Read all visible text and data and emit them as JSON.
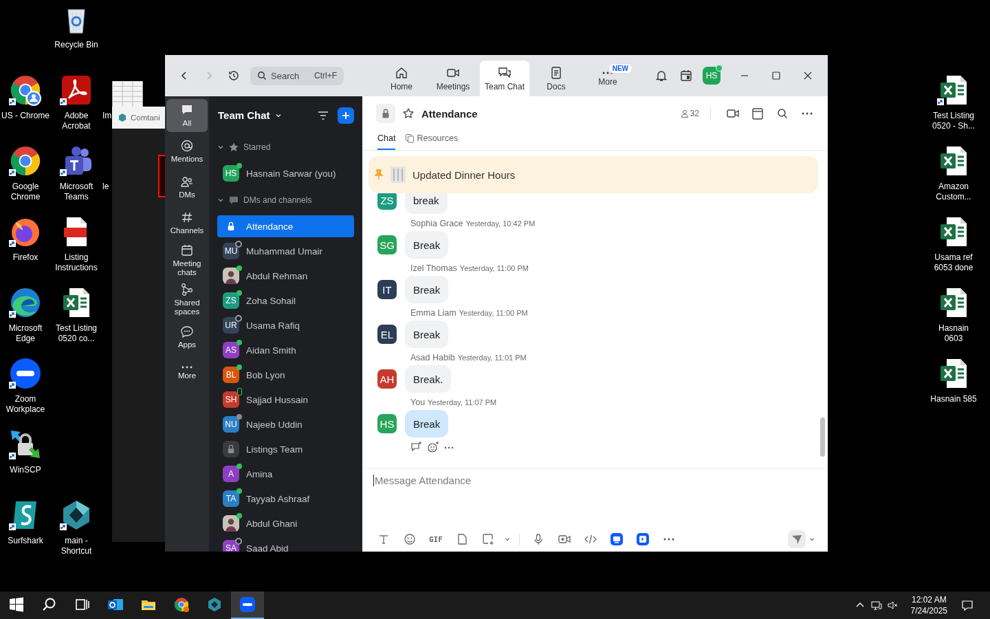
{
  "desktop": {
    "icons": [
      {
        "kind": "recycle",
        "label": "Recycle Bin",
        "shortcut": false
      },
      {
        "kind": "chrome-profile",
        "label": "US - Chrome",
        "shortcut": true
      },
      {
        "kind": "acrobat",
        "label": "Adobe Acrobat",
        "shortcut": true
      },
      {
        "kind": "chrome",
        "label": "Google Chrome",
        "shortcut": true
      },
      {
        "kind": "teams",
        "label": "Microsoft Teams",
        "shortcut": true
      },
      {
        "kind": "firefox",
        "label": "Firefox",
        "shortcut": true
      },
      {
        "kind": "pdf",
        "label": "Listing Instructions",
        "shortcut": false
      },
      {
        "kind": "edge",
        "label": "Microsoft Edge",
        "shortcut": true
      },
      {
        "kind": "excel",
        "label": "Test Listing 0520 co...",
        "shortcut": false
      },
      {
        "kind": "zoom",
        "label": "Zoom Workplace",
        "shortcut": true
      },
      {
        "kind": "winscp",
        "label": "WinSCP",
        "shortcut": true
      },
      {
        "kind": "surfshark",
        "label": "Surfshark",
        "shortcut": true
      },
      {
        "kind": "hexagon",
        "label": "main - Shortcut",
        "shortcut": true
      },
      {
        "kind": "sheet-thumb",
        "label": "Im",
        "shortcut": false
      },
      {
        "kind": "none",
        "label": "le",
        "shortcut": false
      },
      {
        "kind": "excel",
        "label": "Test Listing 0520 - Sh...",
        "shortcut": true
      },
      {
        "kind": "excel",
        "label": "Amazon Custom...",
        "shortcut": false
      },
      {
        "kind": "excel",
        "label": "Usama ref 6053 done",
        "shortcut": false
      },
      {
        "kind": "excel",
        "label": "Hasnain 0603",
        "shortcut": false
      },
      {
        "kind": "excel",
        "label": "Hasnain 585",
        "shortcut": false
      }
    ]
  },
  "background_window": {
    "title": "Comtani"
  },
  "zoom": {
    "search": {
      "placeholder": "Search",
      "shortcut": "Ctrl+F"
    },
    "tabs": [
      {
        "kind": "home",
        "label": "Home",
        "selected": false
      },
      {
        "kind": "meetings",
        "label": "Meetings",
        "selected": false
      },
      {
        "kind": "chat",
        "label": "Team Chat",
        "selected": true
      },
      {
        "kind": "docs",
        "label": "Docs",
        "selected": false
      },
      {
        "kind": "more",
        "label": "More",
        "selected": false,
        "badge": "NEW"
      }
    ],
    "account": {
      "initials": "HS",
      "status": {
        "kind": "dot",
        "color": "#20c05c"
      }
    },
    "rail": [
      {
        "kind": "all",
        "label": "All",
        "selected": true
      },
      {
        "kind": "mentions",
        "label": "Mentions",
        "selected": false
      },
      {
        "kind": "dms",
        "label": "DMs",
        "selected": false
      },
      {
        "kind": "channels",
        "label": "Channels",
        "selected": false
      },
      {
        "kind": "meeting-chats",
        "label": "Meeting chats",
        "selected": false
      },
      {
        "kind": "shared",
        "label": "Shared spaces",
        "selected": false
      },
      {
        "kind": "apps",
        "label": "Apps",
        "selected": false
      },
      {
        "kind": "more",
        "label": "More",
        "selected": false
      }
    ],
    "list": {
      "title": "Team Chat",
      "sections": [
        {
          "kind": "starred",
          "label": "Starred",
          "expanded": true,
          "items": [
            {
              "kind": "person",
              "name": "Hasnain Sarwar (you)",
              "initials": "HS",
              "color": "#22a559",
              "status": {
                "kind": "dot",
                "color": "#2bc35c"
              },
              "selected": false
            }
          ]
        },
        {
          "kind": "dms",
          "label": "DMs and channels",
          "expanded": true,
          "items": [
            {
              "kind": "channel",
              "name": "Attendance",
              "selected": true
            },
            {
              "kind": "person",
              "name": "Muhammad Umair",
              "initials": "MU",
              "color": "#33435a",
              "status": {
                "kind": "ring",
                "color": "#9a9b9f"
              },
              "selected": false
            },
            {
              "kind": "photo",
              "name": "Abdul Rehman",
              "status": {
                "kind": "dot",
                "color": "#2bc35c"
              },
              "selected": false
            },
            {
              "kind": "person",
              "name": "Zoha Sohail",
              "initials": "ZS",
              "color": "#1b9c82",
              "status": {
                "kind": "dot",
                "color": "#2bc35c"
              },
              "selected": false
            },
            {
              "kind": "person",
              "name": "Usama Rafiq",
              "initials": "UR",
              "color": "#33435a",
              "status": {
                "kind": "ring",
                "color": "#9a9b9f"
              },
              "selected": false
            },
            {
              "kind": "person",
              "name": "Aidan Smith",
              "initials": "AS",
              "color": "#8e3fc2",
              "status": {
                "kind": "dot",
                "color": "#2bc35c"
              },
              "selected": false
            },
            {
              "kind": "person",
              "name": "Bob Lyon",
              "initials": "BL",
              "color": "#d9560f",
              "status": {
                "kind": "dot",
                "color": "#2bc35c"
              },
              "selected": false
            },
            {
              "kind": "person",
              "name": "Sajjad Hussain",
              "initials": "SH",
              "color": "#c63a2f",
              "status": {
                "kind": "phone",
                "color": "#2bc35c"
              },
              "selected": false
            },
            {
              "kind": "person",
              "name": "Najeeb Uddin",
              "initials": "NU",
              "color": "#2b7fc4",
              "status": {
                "kind": "dot",
                "color": "#8a8b8f"
              },
              "selected": false
            },
            {
              "kind": "channel",
              "name": "Listings Team",
              "selected": false
            },
            {
              "kind": "person",
              "name": "Amina",
              "initials": "A",
              "color": "#8e3fc2",
              "status": {
                "kind": "dot",
                "color": "#2bc35c"
              },
              "selected": false
            },
            {
              "kind": "person",
              "name": "Tayyab Ashraaf",
              "initials": "TA",
              "color": "#2b7fc4",
              "status": {
                "kind": "dot",
                "color": "#2bc35c"
              },
              "selected": false
            },
            {
              "kind": "photo",
              "name": "Abdul Ghani",
              "status": {
                "kind": "dot",
                "color": "#2bc35c"
              },
              "selected": false
            },
            {
              "kind": "person",
              "name": "Saad Abid",
              "initials": "SA",
              "color": "#8e3fc2",
              "status": {
                "kind": "ring",
                "color": "#9a9b9f"
              },
              "selected": false
            }
          ]
        }
      ]
    },
    "channel": {
      "name": "Attendance",
      "members": "32",
      "tabs": [
        {
          "kind": "chat",
          "label": "Chat",
          "selected": true
        },
        {
          "kind": "resources",
          "label": "Resources",
          "selected": false
        }
      ],
      "pinned": "Updated Dinner Hours",
      "messages": [
        {
          "initials": "ZS",
          "color": "#1b9c82",
          "text": "break",
          "mine": false
        },
        {
          "sender": "Sophia Grace",
          "time": "Yesterday, 10:42 PM",
          "initials": "SG",
          "color": "#27a55a",
          "text": "Break",
          "mine": false
        },
        {
          "sender": "Izel Thomas",
          "time": "Yesterday, 11:00 PM",
          "initials": "IT",
          "color": "#2c3e57",
          "text": "Break",
          "mine": false
        },
        {
          "sender": "Emma Liam",
          "time": "Yesterday, 11:00 PM",
          "initials": "EL",
          "color": "#2c3e57",
          "text": "Break",
          "mine": false
        },
        {
          "sender": "Asad Habib",
          "time": "Yesterday, 11:01 PM",
          "initials": "AH",
          "color": "#c63a2f",
          "text": "Break.",
          "mine": false
        },
        {
          "sender": "You",
          "time": "Yesterday, 11:07 PM",
          "initials": "HS",
          "color": "#27a55a",
          "text": "Break",
          "mine": true
        }
      ],
      "composer": {
        "placeholder": "Message Attendance",
        "gif": "GIF"
      }
    }
  },
  "taskbar": {
    "apps": [
      {
        "kind": "start",
        "active": false
      },
      {
        "kind": "search",
        "active": false
      },
      {
        "kind": "taskview",
        "active": false
      },
      {
        "kind": "outlook",
        "active": false
      },
      {
        "kind": "explorer",
        "active": false
      },
      {
        "kind": "chrome",
        "active": false
      },
      {
        "kind": "hexagon",
        "active": false
      },
      {
        "kind": "zoom",
        "active": true
      }
    ],
    "time": "12:02 AM",
    "date": "7/24/2025"
  }
}
